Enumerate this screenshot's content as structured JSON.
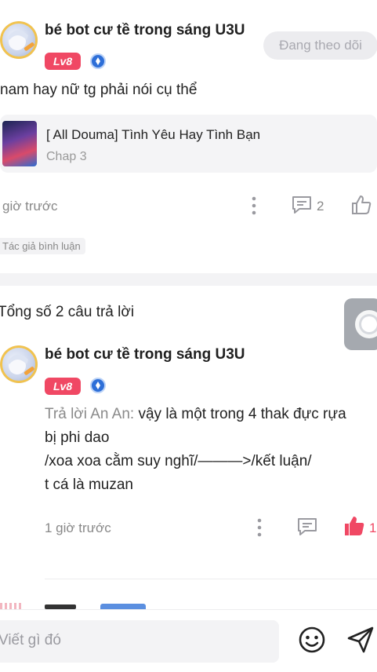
{
  "comment": {
    "username": "bé bot cư tề trong sáng U3U",
    "level": "Lv8",
    "follow_label": "Đang theo dõi",
    "text": "nam hay nữ tg phải nói cụ thể",
    "book": {
      "title": "[ All Douma] Tình Yêu Hay Tình Bạn",
      "chapter": "Chap 3"
    },
    "time": "giờ trước",
    "comment_count": "2",
    "author_tag": "Tác giả bình luận"
  },
  "replies_header": "Tổng số 2 câu trả lời",
  "reply": {
    "username": "bé bot cư tề trong sáng U3U",
    "level": "Lv8",
    "reply_prefix": "Trả lời An An:",
    "line1": " vậy là một trong 4 thak đực rựa",
    "line2": "bị phi dao",
    "line3": "/xoa xoa cằm suy nghĩ/———>/kết luận/",
    "line4": "t cá là muzan",
    "time": "1 giờ trước",
    "like_count": "1"
  },
  "composer": {
    "placeholder": "Viết gì đó"
  },
  "colors": {
    "accent_pink": "#f04864",
    "level_badge": "#f04864",
    "verified_blue": "#2e6fd8",
    "follow_bg": "#ececef"
  },
  "icons": {
    "more": "more-vertical-icon",
    "comment": "comment-icon",
    "like": "thumbs-up-icon",
    "emoji": "smiley-icon",
    "send": "send-icon"
  }
}
